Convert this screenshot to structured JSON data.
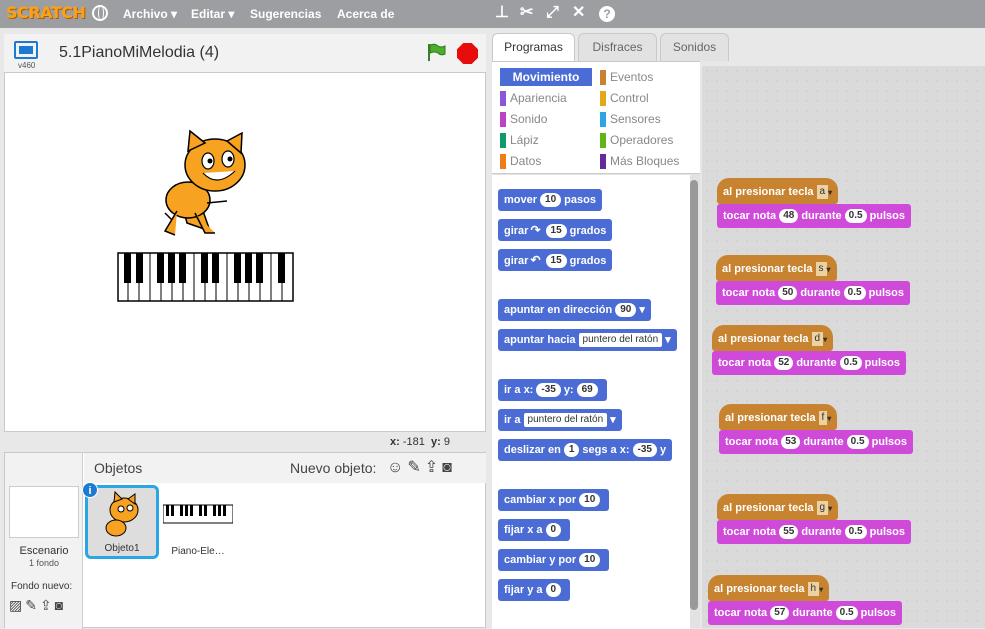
{
  "topbar": {
    "logo": "SCRATCH",
    "menus": [
      "Archivo",
      "Editar",
      "Sugerencias",
      "Acerca de"
    ]
  },
  "stage": {
    "version": "v460",
    "project_title": "5.1PianoMiMelodia (4)",
    "coords": {
      "x_label": "x:",
      "x_value": "-181",
      "y_label": "y:",
      "y_value": "9"
    }
  },
  "sprites": {
    "title": "Objetos",
    "new_object_label": "Nuevo objeto:",
    "stage_name": "Escenario",
    "stage_backdrops": "1 fondo",
    "new_backdrop_label": "Fondo nuevo:",
    "items": [
      {
        "name": "Objeto1",
        "selected": true
      },
      {
        "name": "Piano-Ele…",
        "selected": false
      }
    ]
  },
  "tabs": [
    "Programas",
    "Disfraces",
    "Sonidos"
  ],
  "categories": [
    {
      "label": "Movimiento",
      "color": "#4a6cd4",
      "active": true
    },
    {
      "label": "Eventos",
      "color": "#c88330"
    },
    {
      "label": "Apariencia",
      "color": "#8a55d7"
    },
    {
      "label": "Control",
      "color": "#e1a91a"
    },
    {
      "label": "Sonido",
      "color": "#bb42c3"
    },
    {
      "label": "Sensores",
      "color": "#2ca5e2"
    },
    {
      "label": "Lápiz",
      "color": "#0e9a6c"
    },
    {
      "label": "Operadores",
      "color": "#5cb712"
    },
    {
      "label": "Datos",
      "color": "#ee7d16"
    },
    {
      "label": "Más Bloques",
      "color": "#632d99"
    }
  ],
  "blocks": {
    "mover": {
      "pre": "mover",
      "num": "10",
      "post": "pasos"
    },
    "girar_r": {
      "pre": "girar",
      "num": "15",
      "post": "grados"
    },
    "girar_l": {
      "pre": "girar",
      "num": "15",
      "post": "grados"
    },
    "apuntar_dir": {
      "pre": "apuntar en dirección",
      "num": "90"
    },
    "apuntar_hacia": {
      "pre": "apuntar hacia",
      "drop": "puntero del ratón"
    },
    "ir_a_xy": {
      "pre": "ir a x:",
      "x": "-35",
      "mid": "y:",
      "y": "69"
    },
    "ir_a": {
      "pre": "ir a",
      "drop": "puntero del ratón"
    },
    "deslizar": {
      "pre": "deslizar en",
      "num": "1",
      "mid": "segs a x:",
      "x": "-35",
      "post": "y"
    },
    "cambiar_x": {
      "pre": "cambiar x por",
      "num": "10"
    },
    "fijar_x": {
      "pre": "fijar x a",
      "num": "0"
    },
    "cambiar_y": {
      "pre": "cambiar y por",
      "num": "10"
    },
    "fijar_y": {
      "pre": "fijar y a",
      "num": "0"
    }
  },
  "scripts": [
    {
      "hat": "al presionar tecla",
      "key": "a",
      "play": "tocar nota",
      "note": "48",
      "during": "durante",
      "beats": "0.5",
      "unit": "pulsos"
    },
    {
      "hat": "al presionar tecla",
      "key": "s",
      "play": "tocar nota",
      "note": "50",
      "during": "durante",
      "beats": "0.5",
      "unit": "pulsos"
    },
    {
      "hat": "al presionar tecla",
      "key": "d",
      "play": "tocar nota",
      "note": "52",
      "during": "durante",
      "beats": "0.5",
      "unit": "pulsos"
    },
    {
      "hat": "al presionar tecla",
      "key": "f",
      "play": "tocar nota",
      "note": "53",
      "during": "durante",
      "beats": "0.5",
      "unit": "pulsos"
    },
    {
      "hat": "al presionar tecla",
      "key": "g",
      "play": "tocar nota",
      "note": "55",
      "during": "durante",
      "beats": "0.5",
      "unit": "pulsos"
    },
    {
      "hat": "al presionar tecla",
      "key": "h",
      "play": "tocar nota",
      "note": "57",
      "during": "durante",
      "beats": "0.5",
      "unit": "pulsos"
    }
  ]
}
